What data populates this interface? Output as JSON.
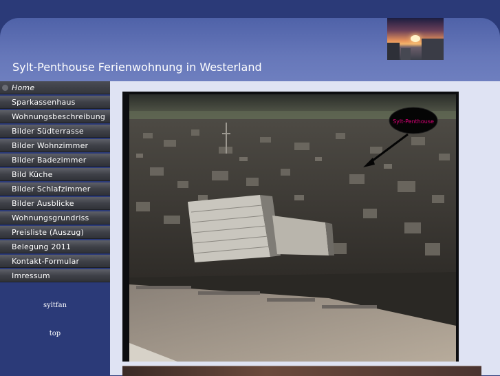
{
  "header": {
    "title": "Sylt-Penthouse  Ferienwohnung in Westerland"
  },
  "nav": {
    "items": [
      {
        "label": "Home",
        "active": true
      },
      {
        "label": "Sparkassenhaus"
      },
      {
        "label": "Wohnungsbeschreibung"
      },
      {
        "label": "Bilder Südterrasse"
      },
      {
        "label": "Bilder Wohnzimmer"
      },
      {
        "label": "Bilder Badezimmer"
      },
      {
        "label": "Bild Küche"
      },
      {
        "label": "Bilder Schlafzimmer"
      },
      {
        "label": "Bilder Ausblicke"
      },
      {
        "label": "Wohnungsgrundriss"
      },
      {
        "label": "Preisliste (Auszug)"
      },
      {
        "label": "Belegung 2011"
      },
      {
        "label": "Kontakt-Formular"
      },
      {
        "label": "Imressum"
      }
    ]
  },
  "sidebar": {
    "link1": "syltfan",
    "link2": "top"
  },
  "photo": {
    "annotation": "Sylt-Penthouse"
  },
  "colors": {
    "page_bg": "#2b3a78",
    "header_bg": "#6677b9",
    "content_bg": "#dfe3f3",
    "nav_bg": "#3f4148",
    "annotation": "#e0007a"
  }
}
